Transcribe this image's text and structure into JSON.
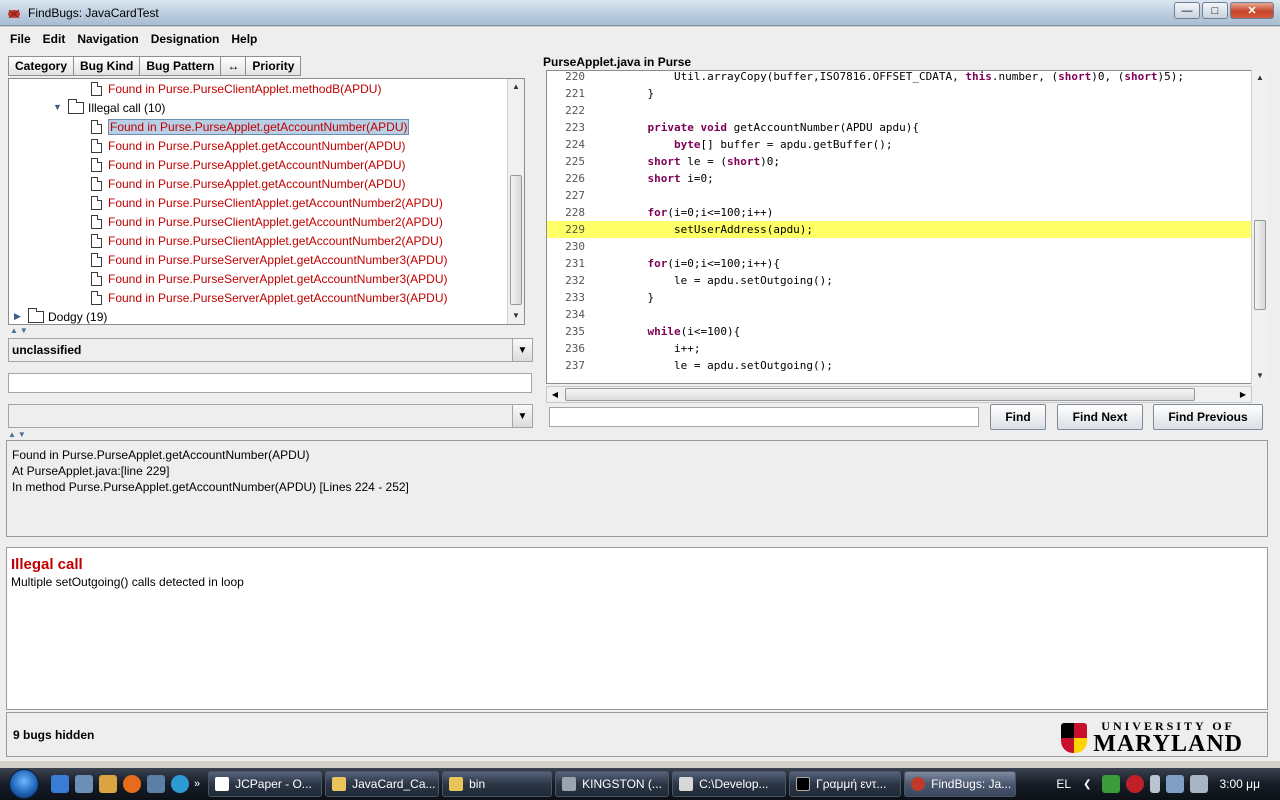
{
  "window": {
    "title": "FindBugs: JavaCardTest"
  },
  "menu": [
    "File",
    "Edit",
    "Navigation",
    "Designation",
    "Help"
  ],
  "sort_tabs": [
    "Category",
    "Bug Kind",
    "Bug Pattern",
    "↔",
    "Priority"
  ],
  "tree": {
    "top_item": "Found in Purse.PurseClientApplet.methodB(APDU)",
    "group": "Illegal call (10)",
    "items": [
      "Found in Purse.PurseApplet.getAccountNumber(APDU)",
      "Found in Purse.PurseApplet.getAccountNumber(APDU)",
      "Found in Purse.PurseApplet.getAccountNumber(APDU)",
      "Found in Purse.PurseApplet.getAccountNumber(APDU)",
      "Found in Purse.PurseClientApplet.getAccountNumber2(APDU)",
      "Found in Purse.PurseClientApplet.getAccountNumber2(APDU)",
      "Found in Purse.PurseClientApplet.getAccountNumber2(APDU)",
      "Found in Purse.PurseServerApplet.getAccountNumber3(APDU)",
      "Found in Purse.PurseServerApplet.getAccountNumber3(APDU)",
      "Found in Purse.PurseServerApplet.getAccountNumber3(APDU)"
    ],
    "next_group": "Dodgy (19)"
  },
  "designation": {
    "selected": "unclassified"
  },
  "source": {
    "title": "PurseApplet.java in Purse",
    "lines": [
      {
        "n": "220",
        "pre": "        Util.arrayCopy(buffer,ISO7816.OFFSET_CDATA, ",
        "kw": "this",
        "post": ".number, (",
        "kw2": "short",
        "post2": ")0, (",
        "kw3": "short",
        "post3": ")5);"
      },
      {
        "n": "221",
        "pre": "    }"
      },
      {
        "n": "222",
        "pre": ""
      },
      {
        "n": "223",
        "pre": "    ",
        "kw": "private void",
        "post": " getAccountNumber(APDU apdu){"
      },
      {
        "n": "224",
        "pre": "        ",
        "kw": "byte",
        "post": "[] buffer = apdu.getBuffer();"
      },
      {
        "n": "225",
        "pre": "    ",
        "kw": "short",
        "post": " le = (",
        "kw2": "short",
        "post2": ")0;"
      },
      {
        "n": "226",
        "pre": "    ",
        "kw": "short",
        "post": " i=0;"
      },
      {
        "n": "227",
        "pre": ""
      },
      {
        "n": "228",
        "pre": "    ",
        "kw": "for",
        "post": "(i=0;i<=100;i++)"
      },
      {
        "n": "229",
        "pre": "        setUserAddress(apdu);"
      },
      {
        "n": "230",
        "pre": ""
      },
      {
        "n": "231",
        "pre": "    ",
        "kw": "for",
        "post": "(i=0;i<=100;i++){"
      },
      {
        "n": "232",
        "pre": "        le = apdu.setOutgoing();"
      },
      {
        "n": "233",
        "pre": "    }"
      },
      {
        "n": "234",
        "pre": ""
      },
      {
        "n": "235",
        "pre": "    ",
        "kw": "while",
        "post": "(i<=100){"
      },
      {
        "n": "236",
        "pre": "        i++;"
      },
      {
        "n": "237",
        "pre": "        le = apdu.setOutgoing();"
      }
    ],
    "highlight_line": "229"
  },
  "find": {
    "value": "",
    "find_label": "Find",
    "next_label": "Find Next",
    "prev_label": "Find Previous"
  },
  "details": {
    "line1": "Found in Purse.PurseApplet.getAccountNumber(APDU)",
    "line2": "At PurseApplet.java:[line 229]",
    "line3": "In method Purse.PurseApplet.getAccountNumber(APDU) [Lines 224 - 252]"
  },
  "description": {
    "title": "Illegal call",
    "body": "Multiple setOutgoing() calls detected in loop"
  },
  "status": {
    "text": "9 bugs hidden"
  },
  "logo": {
    "line1": "UNIVERSITY OF",
    "line2": "MARYLAND"
  },
  "taskbar": {
    "tasks": [
      "JCPaper - O...",
      "JavaCard_Ca...",
      "bin",
      "KINGSTON (...",
      "C:\\Develop...",
      "Γραμμή εντ...",
      "FindBugs: Ja..."
    ],
    "lang": "EL",
    "clock": "3:00 μμ"
  }
}
